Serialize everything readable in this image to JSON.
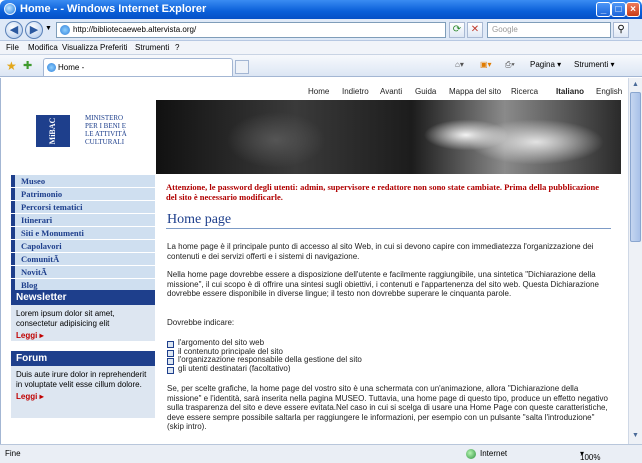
{
  "window": {
    "title": "Home - - Windows Internet Explorer",
    "url": "http://bibliotecaeweb.altervista.org/",
    "search_placeholder": "Google",
    "tab_label": "Home -"
  },
  "menubar": [
    "File",
    "Modifica",
    "Visualizza",
    "Preferiti",
    "Strumenti",
    "?"
  ],
  "toolbar": {
    "page_label": "Pagina",
    "tools_label": "Strumenti"
  },
  "status": {
    "text": "Fine",
    "zone": "Internet",
    "zoom": "100%"
  },
  "site": {
    "topnav": [
      "Home",
      "Indietro",
      "Avanti",
      "Guida",
      "Mappa del sito",
      "Ricerca",
      "Italiano",
      "English"
    ],
    "logo_mark": "MiBAC",
    "logo_text": [
      "MINISTERO",
      "PER I BENI E",
      "LE ATTIVITÀ",
      "CULTURALI"
    ],
    "menu": [
      "Museo",
      "Patrimonio",
      "Percorsi tematici",
      "Itinerari",
      "Siti e Monumenti",
      "Capolavori",
      "ComunitÃ",
      "NovitÃ",
      "Blog"
    ],
    "newsletter": {
      "title": "Newsletter",
      "text": "Lorem ipsum dolor sit amet, consectetur adipisicing elit",
      "more": "Leggi"
    },
    "forum": {
      "title": "Forum",
      "text": "Duis aute irure dolor in reprehenderit in voluptate velit esse cillum dolore.",
      "more": "Leggi"
    },
    "warning": "Attenzione, le password degli utenti: admin, supervisore e redattore non sono state cambiate. Prima della pubblicazione del sito è necessario modificarle.",
    "heading": "Home page",
    "paragraphs": [
      "La home page è il principale punto di accesso al sito Web, in cui si devono capire con immediatezza l'organizzazione dei contenuti e dei servizi offerti e i sistemi di navigazione.",
      "Nella home page dovrebbe essere a disposizione dell'utente e facilmente raggiungibile, una sintetica \"Dichiarazione della missione\", il cui scopo è di offrire una sintesi sugli obiettivi, i contenuti e l'appartenenza del sito web. Questa Dichiarazione dovrebbe essere disponibile in diverse lingue; il testo non dovrebbe superare le cinquanta parole.",
      "Dovrebbe indicare:",
      "Se, per scelte grafiche, la home page del vostro sito è una schermata con un'animazione, allora \"Dichiarazione della missione\" e l'identità, sarà inserita nella pagina MUSEO. Tuttavia, una home page di questo tipo, produce un effetto negativo sulla trasparenza del sito e deve essere evitata.Nel caso in cui si scelga di usare una Home Page con queste caratteristiche, deve essere sempre possibile saltarla per raggiungere le informazioni, per esempio con un pulsante \"salta l'introduzione\" (skip intro)."
    ],
    "list": [
      "l'argomento del sito web",
      "il contenuto principale del sito",
      "l'organizzazione responsabile della gestione del sito",
      "gli utenti destinatari (facoltativo)"
    ]
  }
}
